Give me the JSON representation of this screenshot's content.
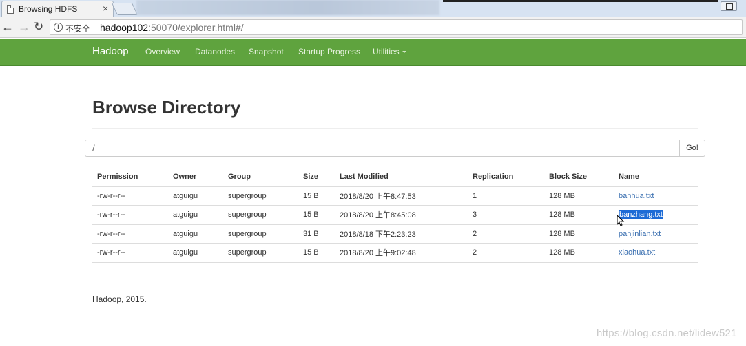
{
  "browser": {
    "tab_title": "Browsing HDFS",
    "tab_close": "×",
    "security_label": "不安全",
    "url_host": "hadoop102",
    "url_rest": ":50070/explorer.html#/",
    "back_icon": "←",
    "forward_icon": "→",
    "reload_icon": "↻"
  },
  "navbar": {
    "brand": "Hadoop",
    "links": [
      "Overview",
      "Datanodes",
      "Snapshot",
      "Startup Progress",
      "Utilities"
    ],
    "color": "#5fa33e"
  },
  "page": {
    "title": "Browse Directory",
    "path_value": "/",
    "go_label": "Go!"
  },
  "table": {
    "headers": [
      "Permission",
      "Owner",
      "Group",
      "Size",
      "Last Modified",
      "Replication",
      "Block Size",
      "Name"
    ],
    "rows": [
      [
        "-rw-r--r--",
        "atguigu",
        "supergroup",
        "15 B",
        "2018/8/20 上午8:47:53",
        "1",
        "128 MB",
        "banhua.txt"
      ],
      [
        "-rw-r--r--",
        "atguigu",
        "supergroup",
        "15 B",
        "2018/8/20 上午8:45:08",
        "3",
        "128 MB",
        "banzhang.txt"
      ],
      [
        "-rw-r--r--",
        "atguigu",
        "supergroup",
        "31 B",
        "2018/8/18 下午2:23:23",
        "2",
        "128 MB",
        "panjinlian.txt"
      ],
      [
        "-rw-r--r--",
        "atguigu",
        "supergroup",
        "15 B",
        "2018/8/20 上午9:02:48",
        "2",
        "128 MB",
        "xiaohua.txt"
      ]
    ],
    "selected_row": 1,
    "link_color": "#3a6fb0"
  },
  "footer": {
    "text": "Hadoop, 2015."
  },
  "watermark": "https://blog.csdn.net/lidew521"
}
